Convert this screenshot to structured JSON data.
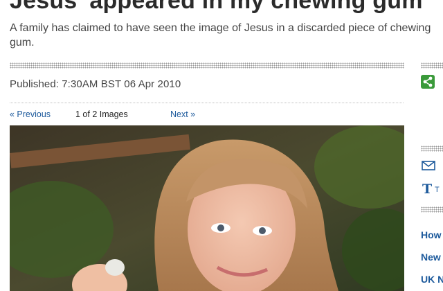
{
  "article": {
    "headline": "Jesus' appeared in my chewing gum",
    "standfirst": "A family has claimed to have seen the image of Jesus in a discarded piece of chewing gum.",
    "published_label": "Published:",
    "published_value": "7:30AM BST 06 Apr 2010"
  },
  "gallery": {
    "prev_label": "« Previous",
    "counter": "1 of 2 Images",
    "next_label": "Next »",
    "photo_alt": "Girl holding a piece of chewing gum"
  },
  "rail": {
    "share_icon": "share-icon",
    "email_icon": "envelope-icon",
    "text_icon": "text-size-icon",
    "text_initial": "T",
    "links": [
      "How",
      "New",
      "UK N"
    ]
  },
  "colors": {
    "link": "#1d5a9c",
    "share_green": "#3a9a3a"
  }
}
